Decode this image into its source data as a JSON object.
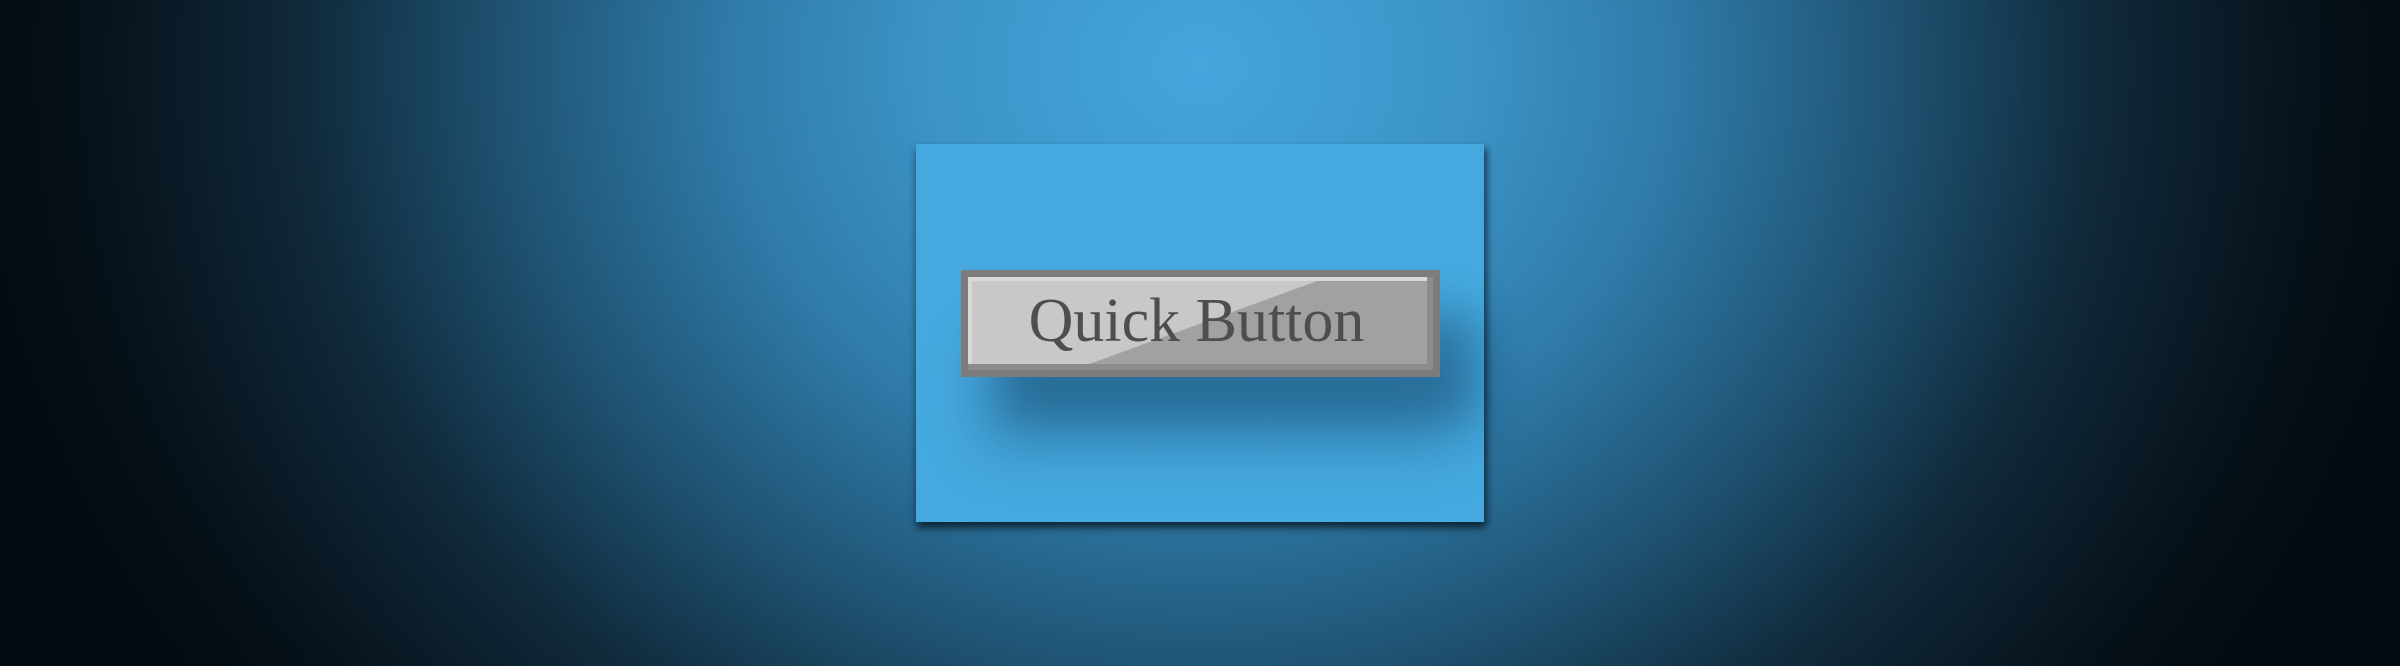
{
  "panel": {
    "background_color": "#45a9df"
  },
  "button": {
    "label": "Quick Button",
    "border_color": "#7c7c7c",
    "face_light": "#c8c8c8",
    "face_dark": "#a1a1a1",
    "text_color": "#4e4e4e"
  },
  "background": {
    "center_color": "#45a6dd",
    "edge_color": "#040b10"
  }
}
